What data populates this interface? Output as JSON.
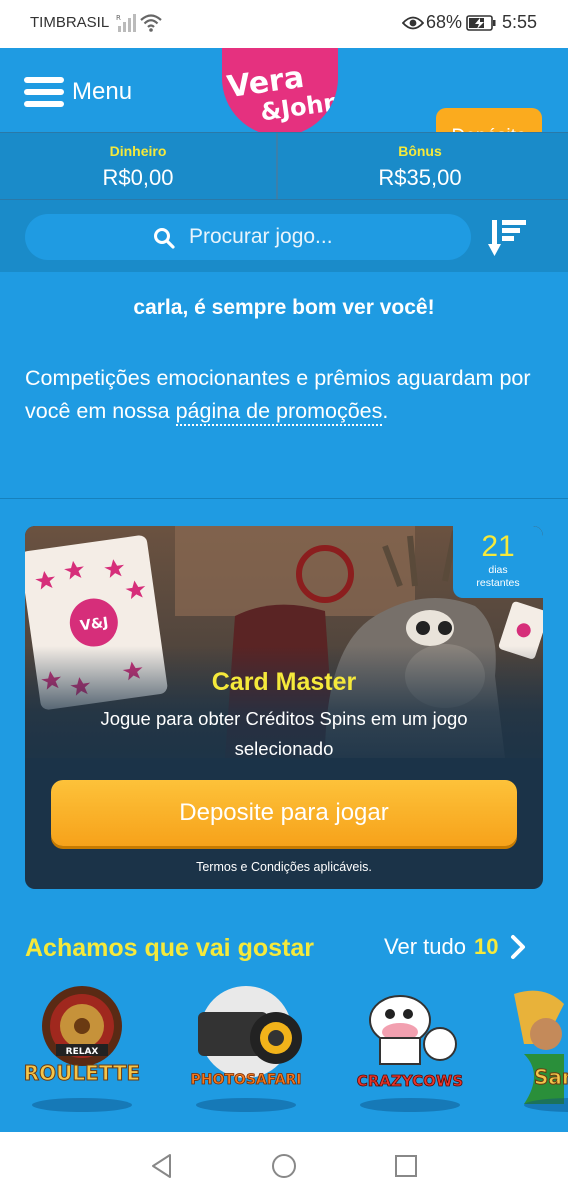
{
  "status_bar": {
    "carrier": "TIMBRASIL",
    "battery": "68%",
    "time": "5:55"
  },
  "header": {
    "menu_label": "Menu",
    "logo_text_top": "Vera",
    "logo_text_bottom": "&John",
    "deposit_label": "Depósito"
  },
  "balance": {
    "money_label": "Dinheiro",
    "money_value": "R$0,00",
    "bonus_label": "Bônus",
    "bonus_value": "R$35,00"
  },
  "search": {
    "placeholder": "Procurar jogo..."
  },
  "greeting": "carla, é sempre bom ver você!",
  "promo": {
    "text": "Competições emocionantes e prêmios aguardam por você em nossa ",
    "link": "página de promoções",
    "end": "."
  },
  "campaign": {
    "days_number": "21",
    "days_label_1": "dias",
    "days_label_2": "restantes",
    "card_badge": "V&J",
    "title": "Card Master",
    "description": "Jogue para obter Créditos Spins em um jogo selecionado",
    "button_label": "Deposite para jogar",
    "terms": "Termos e Condições aplicáveis."
  },
  "recommended": {
    "title": "Achamos que vai gostar",
    "see_all_label": "Ver tudo",
    "count": "10",
    "games": [
      {
        "top_label": "RELAX",
        "label": "ROULETTE"
      },
      {
        "label": "PHOTOSAFARI"
      },
      {
        "label": "CRAZYCOWS"
      },
      {
        "label": "Sam Car"
      }
    ]
  },
  "colors": {
    "background": "#1f9be2",
    "accent_yellow": "#f5e93b",
    "deposit_orange": "#fbab1e",
    "logo_pink": "#e5317f",
    "card_dark": "#1b3348"
  },
  "icons": [
    "signal-icon",
    "wifi-icon",
    "eye-icon",
    "battery-icon",
    "hamburger-icon",
    "search-icon",
    "sort-icon",
    "chevron-right-icon",
    "back-icon",
    "home-icon",
    "recents-icon"
  ]
}
